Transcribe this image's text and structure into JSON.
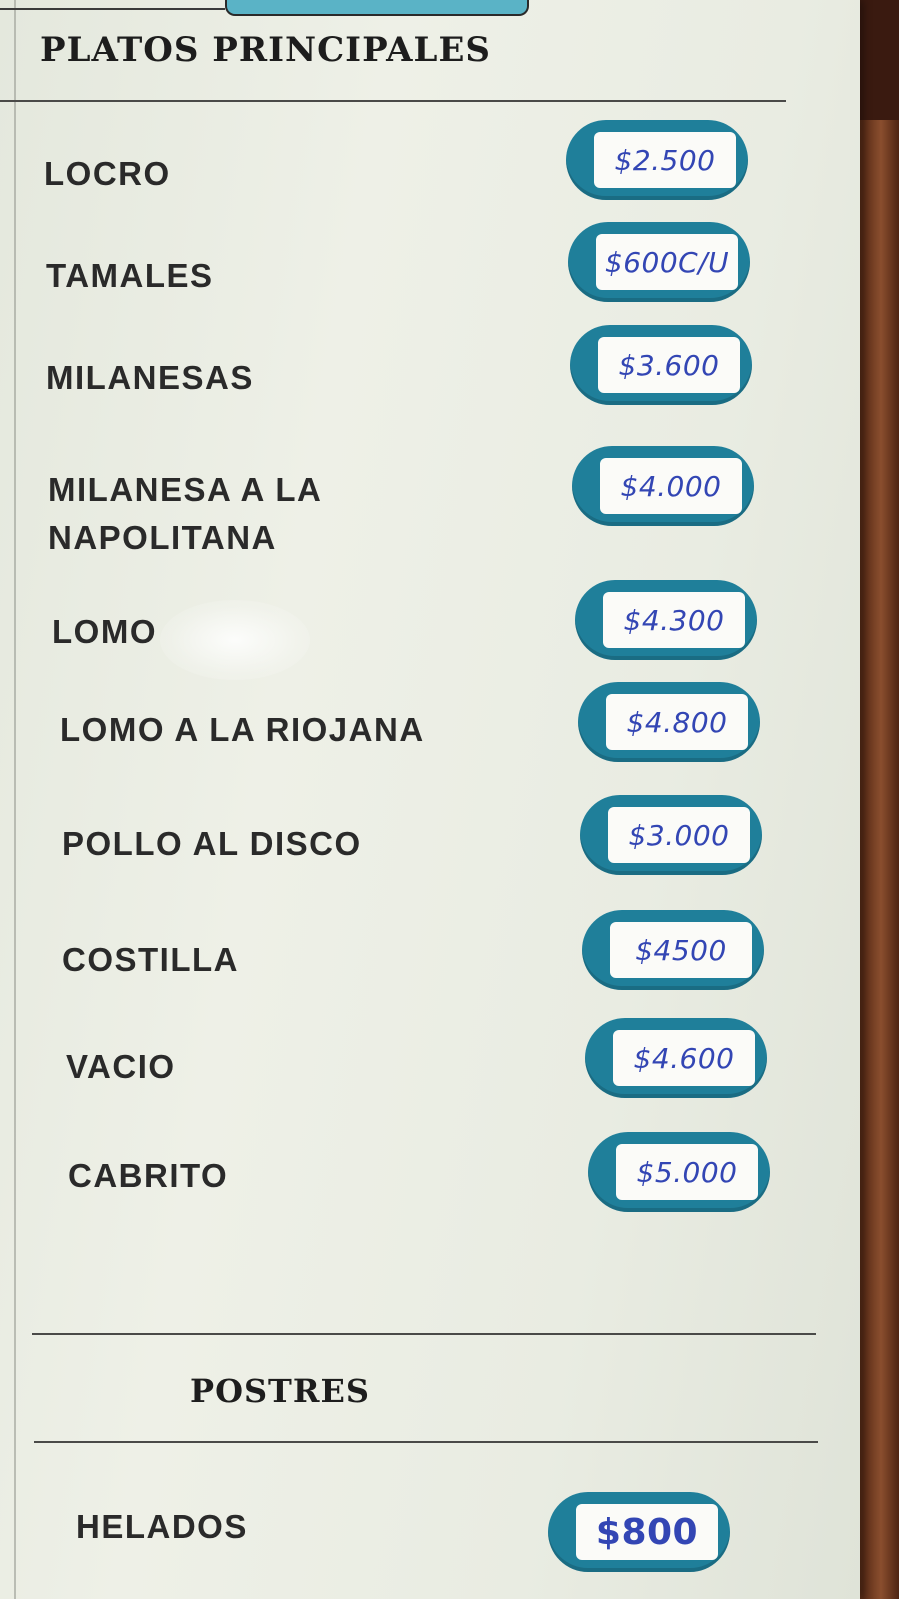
{
  "menu": {
    "main_section_title": "PLATOS PRINCIPALES",
    "dessert_section_title": "POSTRES",
    "main_items": [
      {
        "name": "LOCRO",
        "price": "$2.500"
      },
      {
        "name": "TAMALES",
        "price": "$600C/U"
      },
      {
        "name": "MILANESAS",
        "price": "$3.600"
      },
      {
        "name": "MILANESA A LA NAPOLITANA",
        "price": "$4.000"
      },
      {
        "name": "LOMO",
        "price": "$4.300"
      },
      {
        "name": "LOMO A LA RIOJANA",
        "price": "$4.800"
      },
      {
        "name": "POLLO AL DISCO",
        "price": "$3.000"
      },
      {
        "name": "COSTILLA",
        "price": "$4500"
      },
      {
        "name": "VACIO",
        "price": "$4.600"
      },
      {
        "name": "CABRITO",
        "price": "$5.000"
      }
    ],
    "dessert_items": [
      {
        "name": "HELADOS",
        "price": "$800"
      }
    ]
  },
  "colors": {
    "card_background": "#e9ece2",
    "price_pill": "#1f7f9a",
    "price_ink": "#3346b4",
    "text": "#2a2a2a"
  }
}
